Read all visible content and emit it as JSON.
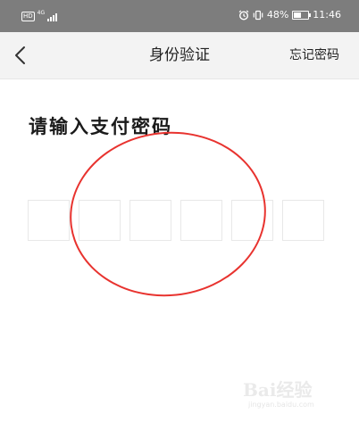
{
  "status_bar": {
    "hd_badge": "HD",
    "network": "4G",
    "battery_percent": "48%",
    "battery_level": 0.48,
    "time": "11:46",
    "icons": [
      "hd-icon",
      "signal-icon",
      "alarm-icon",
      "vibrate-icon",
      "battery-icon"
    ]
  },
  "nav": {
    "back_icon": "chevron-left-icon",
    "title": "身份验证",
    "forgot_label": "忘记密码"
  },
  "main": {
    "prompt": "请输入支付密码",
    "pin_boxes": [
      "",
      "",
      "",
      "",
      "",
      ""
    ]
  },
  "annotation": {
    "shape": "ellipse",
    "color": "#e8332f"
  },
  "watermark": {
    "text": "Bai经验",
    "sub": "jingyan.baidu.com"
  },
  "colors": {
    "status_bar": "#7d7d7d",
    "nav_bar": "#f3f3f3",
    "text": "#1a1a1a",
    "box_border": "#e8e8e8"
  }
}
